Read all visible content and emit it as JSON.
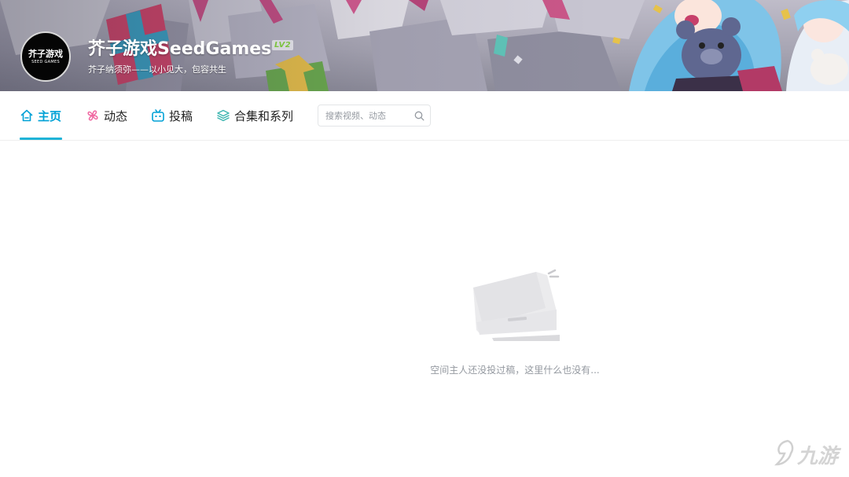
{
  "banner": {
    "avatar_text_cn": "芥子游戏",
    "avatar_text_en": "SEED GAMES",
    "username": "芥子游戏SeedGames",
    "level": "LV2",
    "signature": "芥子纳须弥——以小见大，包容共生"
  },
  "nav": {
    "tabs": [
      {
        "label": "主页",
        "icon": "home-icon",
        "active": true
      },
      {
        "label": "动态",
        "icon": "pinwheel-icon",
        "active": false
      },
      {
        "label": "投稿",
        "icon": "tv-icon",
        "active": false
      },
      {
        "label": "合集和系列",
        "icon": "layers-icon",
        "active": false
      }
    ],
    "search": {
      "placeholder": "搜索视频、动态",
      "value": ""
    }
  },
  "empty_state": {
    "message": "空间主人还没投过稿，这里什么也没有..."
  },
  "watermark": {
    "text": "九游"
  },
  "colors": {
    "accent": "#00a1d6",
    "underline": "#1fb3d7",
    "level_badge": "#7cc240",
    "muted_text": "#9499a0"
  }
}
